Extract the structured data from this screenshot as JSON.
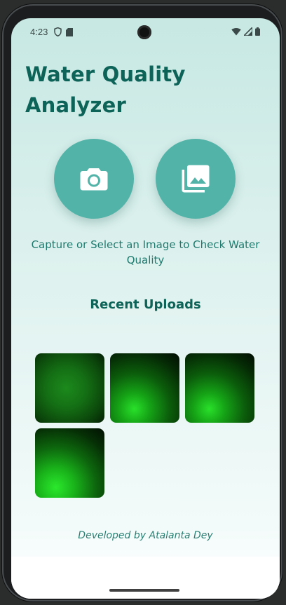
{
  "status_bar": {
    "time": "4:23",
    "left_icons": [
      "shield-icon",
      "sim-card-icon"
    ],
    "right_icons": [
      "wifi-icon",
      "cellular-signal-icon",
      "battery-icon"
    ]
  },
  "app": {
    "title": "Water Quality Analyzer",
    "accent_color": "#0d6358",
    "button_color": "#52b3a8"
  },
  "actions": {
    "camera_icon": "camera-icon",
    "gallery_icon": "photo-library-icon",
    "hint": "Capture or Select an Image to Check Water Quality"
  },
  "recent": {
    "title": "Recent Uploads",
    "count": 4
  },
  "footer": {
    "credit": "Developed by Atalanta Dey"
  }
}
